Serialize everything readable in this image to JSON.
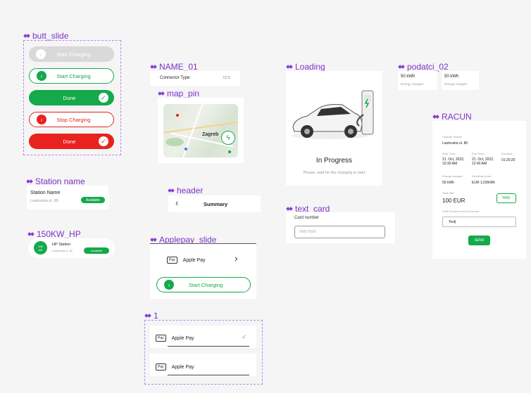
{
  "frames": {
    "butt_slide": "butt_slide",
    "name01": "NAME_01",
    "map_pin": "map_pin",
    "loading": "Loading",
    "podatci": "podatci_02",
    "racun": "RACUN",
    "station_name": "Station name",
    "header": "header",
    "text_card": "text_card",
    "hp": "150KW_HP",
    "applepay_slide": "Applepay_slide",
    "one": "1"
  },
  "butt_slide": {
    "btn1": "Start Charging",
    "btn2": "Start Charging",
    "btn3": "Done",
    "btn4": "Stop Charging",
    "btn5": "Done"
  },
  "name01": {
    "label": "Connector Type:",
    "value": "CCS"
  },
  "map_pin": {
    "city": "Zagreb"
  },
  "loading": {
    "title": "In Progress",
    "subtitle": "Please, wait for the charging to start"
  },
  "podatci": [
    {
      "value": "50 kWh",
      "label": "Energy charged"
    },
    {
      "value": "50 kWh",
      "label": "Energy charged"
    }
  ],
  "racun": {
    "station_label": "Charger Station",
    "station_value": "Lastovska ul. 80",
    "start_label": "Start Time:",
    "start_value": "21. Oct, 2022, 10:30 AM",
    "end_label": "End Time:",
    "end_value": "21. Oct, 2022, 12:40 AM",
    "duration_label": "Duration:",
    "duration_value": "01:20:20",
    "energy_label": "Energy charged:",
    "energy_value": "50 kWh",
    "price_label": "Electricity price:",
    "price_value": "EUR 1,03/kWh",
    "total_label": "Total: Bill:",
    "total_value": "100 EUR",
    "paid": "PAID",
    "email_label": "Enter Email to send a Invoice:",
    "email_value": "Text|",
    "send": "SEND"
  },
  "station": {
    "name": "Station Name",
    "address": "Lastovska ul. 80",
    "badge": "Available"
  },
  "header": {
    "back": "‹",
    "title": "Summary"
  },
  "text_card": {
    "label": "Card number",
    "placeholder": "0000 0000"
  },
  "hp": {
    "badge_top": "150",
    "badge_bottom": "kW",
    "name": "HP Station",
    "address": "Lastovska ul. 80",
    "status": "Available"
  },
  "applepay": {
    "logo": "Pay",
    "label": "Apple Pay",
    "arrow": "›",
    "button": "Start Charging"
  },
  "one": {
    "row1_logo": "Pay",
    "row1_label": "Apple Pay",
    "row1_check": "✓",
    "row2_logo": "Pay",
    "row2_label": "Apple Pay"
  },
  "colors": {
    "green": "#14a94a",
    "red": "#e8221f",
    "purple": "#8a3ad6",
    "grey": "#d8d8d8"
  }
}
